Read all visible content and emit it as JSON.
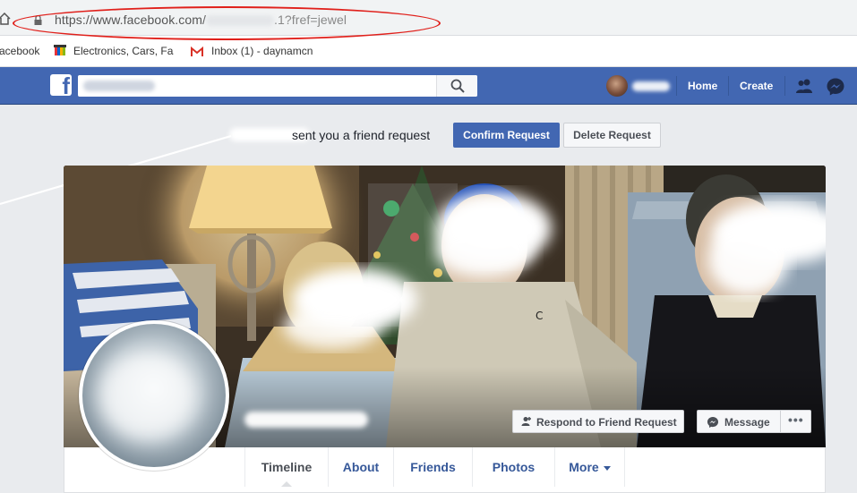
{
  "browser": {
    "url_prefix": "https://www.facebook.com/",
    "url_suffix": ".1?fref=jewel",
    "bookmarks": [
      {
        "label": "acebook",
        "icon": "facebook-icon"
      },
      {
        "label": "Electronics, Cars, Fas",
        "icon": "ebay-icon"
      },
      {
        "label": "Inbox (1) - daynamcn",
        "icon": "gmail-icon"
      }
    ]
  },
  "header": {
    "logo": "f",
    "nav": {
      "home": "Home",
      "create": "Create"
    },
    "icons": {
      "search": "search-icon",
      "friends": "friends-icon",
      "messenger": "messenger-icon"
    }
  },
  "friend_request": {
    "text": "sent you a friend request",
    "confirm": "Confirm Request",
    "delete": "Delete Request"
  },
  "cover": {
    "respond": "Respond to Friend Request",
    "message": "Message",
    "more": "•••"
  },
  "tabs": [
    {
      "label": "Timeline"
    },
    {
      "label": "About"
    },
    {
      "label": "Friends"
    },
    {
      "label": "Photos"
    },
    {
      "label": "More"
    }
  ],
  "colors": {
    "fb_blue": "#4267b2",
    "link_blue": "#365899",
    "annotation_red": "#e0201b"
  }
}
